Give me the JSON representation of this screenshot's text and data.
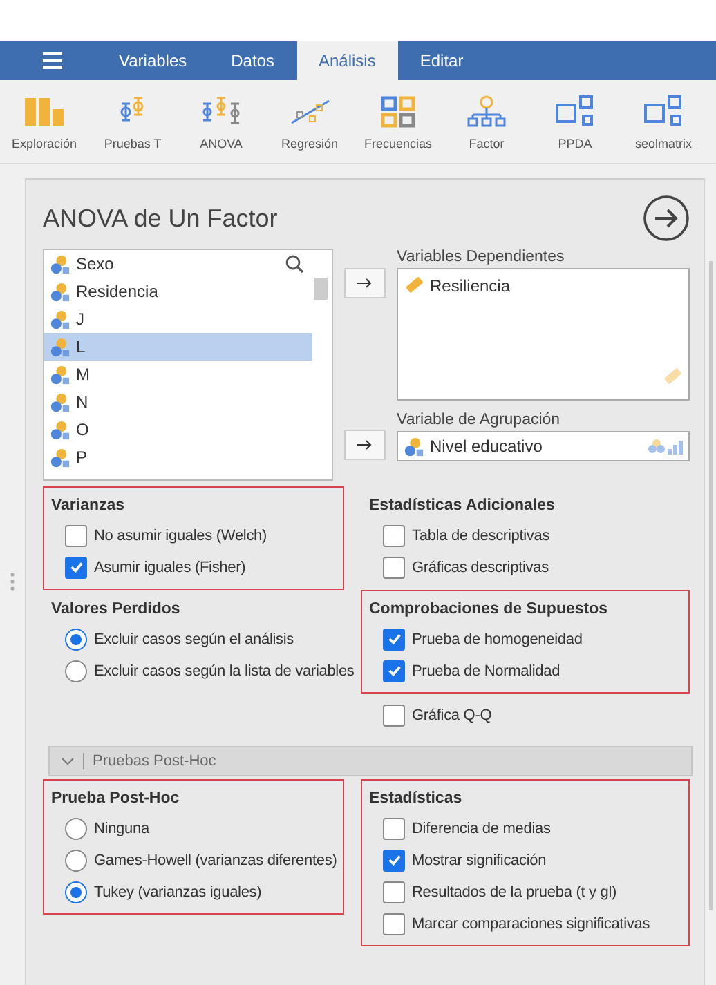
{
  "menu_tabs": [
    {
      "label": "Variables",
      "selected": false
    },
    {
      "label": "Datos",
      "selected": false
    },
    {
      "label": "Análisis",
      "selected": true
    },
    {
      "label": "Editar",
      "selected": false
    }
  ],
  "toolbar": [
    {
      "label": "Exploración"
    },
    {
      "label": "Pruebas T"
    },
    {
      "label": "ANOVA"
    },
    {
      "label": "Regresión"
    },
    {
      "label": "Frecuencias"
    },
    {
      "label": "Factor"
    },
    {
      "label": "PPDA"
    },
    {
      "label": "seolmatrix"
    }
  ],
  "panel": {
    "title": "ANOVA de Un Factor",
    "variables": [
      {
        "name": "Sexo",
        "selected": false
      },
      {
        "name": "Residencia",
        "selected": false
      },
      {
        "name": "J",
        "selected": false
      },
      {
        "name": "L",
        "selected": true
      },
      {
        "name": "M",
        "selected": false
      },
      {
        "name": "N",
        "selected": false
      },
      {
        "name": "O",
        "selected": false
      },
      {
        "name": "P",
        "selected": false
      }
    ],
    "dependent": {
      "label": "Variables Dependientes",
      "items": [
        {
          "name": "Resiliencia",
          "kind": "continuous"
        }
      ]
    },
    "grouping": {
      "label": "Variable de Agrupación",
      "value": {
        "name": "Nivel educativo",
        "kind": "nominal"
      }
    },
    "left_column": [
      {
        "title": "Varianzas",
        "highlighted": true,
        "kind": "checkbox",
        "options": [
          {
            "label": "No asumir iguales (Welch)",
            "checked": false
          },
          {
            "label": "Asumir iguales (Fisher)",
            "checked": true
          }
        ]
      },
      {
        "title": "Valores Perdidos",
        "highlighted": false,
        "kind": "radio",
        "options": [
          {
            "label": "Excluir casos según el análisis",
            "selected": true
          },
          {
            "label": "Excluir casos según la lista de variables",
            "selected": false
          }
        ]
      }
    ],
    "right_column": [
      {
        "title": "Estadísticas Adicionales",
        "highlighted": false,
        "kind": "checkbox",
        "options": [
          {
            "label": "Tabla de descriptivas",
            "checked": false
          },
          {
            "label": "Gráficas descriptivas",
            "checked": false
          }
        ]
      },
      {
        "title": "Comprobaciones de Supuestos",
        "highlighted": true,
        "kind": "checkbox",
        "options": [
          {
            "label": "Prueba de homogeneidad",
            "checked": true
          },
          {
            "label": "Prueba de Normalidad",
            "checked": true
          }
        ]
      },
      {
        "highlighted": false,
        "kind": "checkbox",
        "options": [
          {
            "label": "Gráfica Q-Q",
            "checked": false
          }
        ]
      }
    ],
    "posthoc": {
      "title": "Pruebas Post-Hoc",
      "expanded": true,
      "left_column": [
        {
          "title": "Prueba Post-Hoc",
          "highlighted": true,
          "kind": "radio",
          "options": [
            {
              "label": "Ninguna",
              "selected": false
            },
            {
              "label": "Games-Howell (varianzas diferentes)",
              "selected": false
            },
            {
              "label": "Tukey (varianzas iguales)",
              "selected": true
            }
          ]
        }
      ],
      "right_column": [
        {
          "title": "Estadísticas",
          "highlighted": true,
          "kind": "checkbox",
          "options": [
            {
              "label": "Diferencia de medias",
              "checked": false
            },
            {
              "label": "Mostrar significación",
              "checked": true
            },
            {
              "label": "Resultados de la prueba (t y gl)",
              "checked": false
            },
            {
              "label": "Marcar comparaciones significativas",
              "checked": false
            }
          ]
        }
      ]
    }
  }
}
